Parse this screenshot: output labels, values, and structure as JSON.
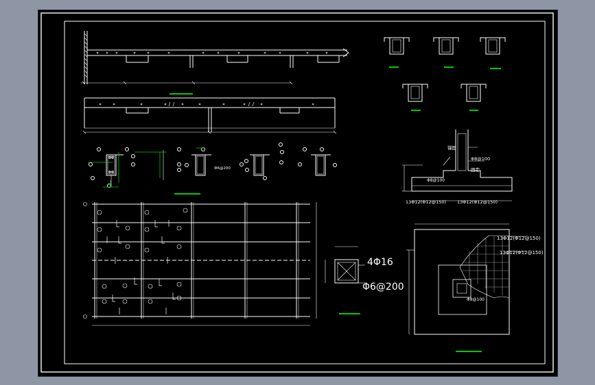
{
  "colors": {
    "background": "#000000",
    "linework": "#ffffff",
    "title_underline": "#00cc00",
    "hatch": "#9a9a9a",
    "surround": "#8e96a6"
  },
  "annotations": {
    "rebar_main": "4Φ16",
    "stirrup": "Φ6@200",
    "slab_bar_1": "13Φ12(Φ12@150)",
    "slab_bar_2": "13Φ12(Φ12@150)",
    "footing_bar_a": "13Φ12(Φ12@150)",
    "footing_bar_b": "13Φ12(Φ12@150)",
    "column_tie": "Φ8@100",
    "column_tie_b": "Φ8@100",
    "column_tie_c": "Φ6@200",
    "footing_label_1": "锚固",
    "footing_label_2": "固定",
    "footing_bar_c": "Φ8@100"
  }
}
